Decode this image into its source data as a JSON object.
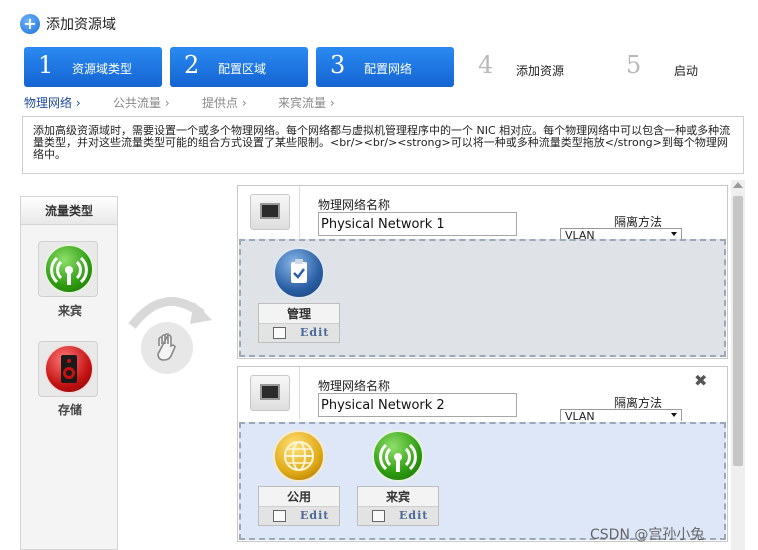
{
  "page": {
    "title": "添加资源域"
  },
  "steps": [
    {
      "num": "1",
      "label": "资源域类型",
      "active": true
    },
    {
      "num": "2",
      "label": "配置区域",
      "active": true
    },
    {
      "num": "3",
      "label": "配置网络",
      "active": true
    },
    {
      "num": "4",
      "label": "添加资源",
      "active": false
    },
    {
      "num": "5",
      "label": "启动",
      "active": false
    }
  ],
  "subtabs": [
    {
      "label": "物理网络",
      "active": true
    },
    {
      "label": "公共流量",
      "active": false
    },
    {
      "label": "提供点",
      "active": false
    },
    {
      "label": "来宾流量",
      "active": false
    }
  ],
  "description": "添加高级资源域时，需要设置一个或多个物理网络。每个网络都与虚拟机管理程序中的一个 NIC 相对应。每个物理网络中可以包含一种或多种流量类型，并对这些流量类型可能的组合方式设置了某些限制。<br/><br/><strong>可以将一种或多种流量类型拖放</strong>到每个物理网络中。",
  "traffic_types": {
    "header": "流量类型",
    "items": [
      {
        "label": "来宾",
        "icon": "guest-traffic-icon"
      },
      {
        "label": "存储",
        "icon": "storage-traffic-icon"
      }
    ]
  },
  "networks": [
    {
      "name_label": "物理网络名称",
      "name_value": "Physical Network 1",
      "isolation_label": "隔离方法",
      "isolation_value": "VLAN",
      "traffic": [
        {
          "label": "管理",
          "edit": "Edit",
          "icon": "management-traffic-icon"
        }
      ]
    },
    {
      "name_label": "物理网络名称",
      "name_value": "Physical Network 2",
      "isolation_label": "隔离方法",
      "isolation_value": "VLAN",
      "close": "✖",
      "traffic": [
        {
          "label": "公用",
          "edit": "Edit",
          "icon": "public-traffic-icon"
        },
        {
          "label": "来宾",
          "edit": "Edit",
          "icon": "guest-traffic-icon"
        }
      ]
    }
  ],
  "watermark": "CSDN @宫孙小兔",
  "colors": {
    "step_active": "#1e6fe0",
    "subtab_active": "#1f4a9c"
  }
}
